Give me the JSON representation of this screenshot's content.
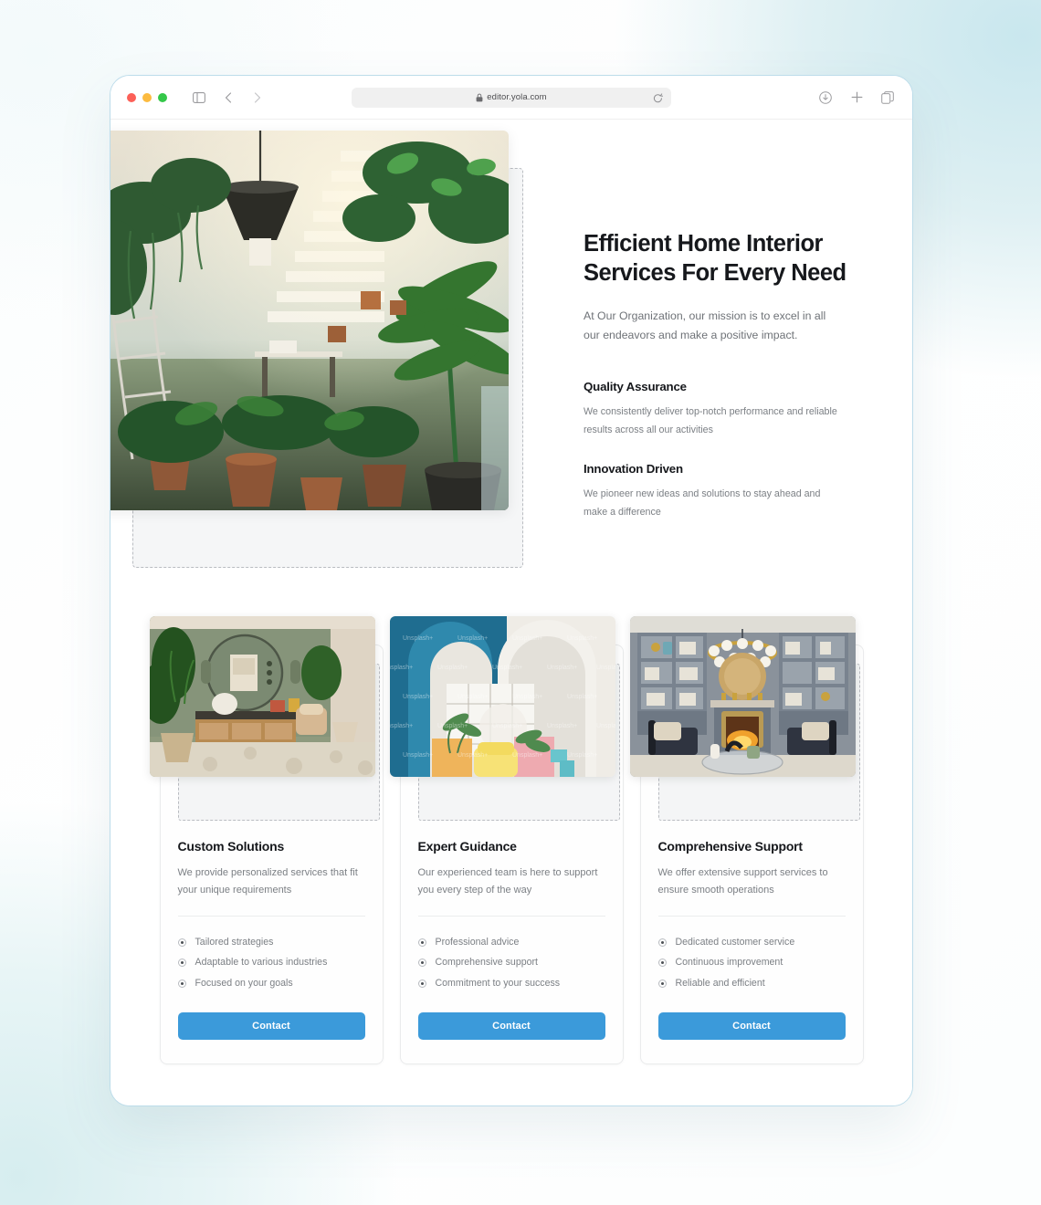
{
  "browser": {
    "url": "editor.yola.com",
    "traffic_lights": [
      "close",
      "minimize",
      "maximize"
    ],
    "left_icons": [
      "sidebar-icon",
      "back-arrow-icon",
      "forward-arrow-icon"
    ],
    "shield_icon": "privacy-shield-icon",
    "lock_icon": "lock-icon",
    "reload_icon": "reload-icon",
    "right_icons": [
      "download-icon",
      "new-tab-plus-icon",
      "tab-overview-icon"
    ]
  },
  "hero": {
    "title": "Efficient Home Interior Services For Every Need",
    "subtitle": "At Our Organization, our mission is to excel in all our endeavors and make a positive impact.",
    "image_alt": "indoor-plant-filled-atrium-photo",
    "features": [
      {
        "heading": "Quality Assurance",
        "body": "We consistently deliver top-notch performance and reliable results across all our activities"
      },
      {
        "heading": "Innovation Driven",
        "body": "We pioneer new ideas and solutions to stay ahead and make a difference"
      }
    ]
  },
  "cards": [
    {
      "image_alt": "green-living-room-with-round-mirror",
      "title": "Custom Solutions",
      "description": "We provide personalized services that fit your unique requirements",
      "bullets": [
        "Tailored strategies",
        "Adaptable to various industries",
        "Focused on your goals"
      ],
      "button_label": "Contact"
    },
    {
      "image_alt": "blue-arch-interior-with-yellow-chair",
      "title": "Expert Guidance",
      "description": "Our experienced team is here to support you every step of the way",
      "bullets": [
        "Professional advice",
        "Comprehensive support",
        "Commitment to your success"
      ],
      "button_label": "Contact",
      "watermark": "Unsplash+"
    },
    {
      "image_alt": "grey-library-with-fireplace-and-chandelier",
      "title": "Comprehensive Support",
      "description": "We offer extensive support services to ensure smooth operations",
      "bullets": [
        "Dedicated customer service",
        "Continuous improvement",
        "Reliable and efficient"
      ],
      "button_label": "Contact"
    }
  ],
  "colors": {
    "accent_blue": "#3b9ada",
    "heading": "#16181c",
    "body_text": "#7b7f84",
    "frame_border": "#bcdcea",
    "page_bg_tint": "#cde9ef"
  }
}
